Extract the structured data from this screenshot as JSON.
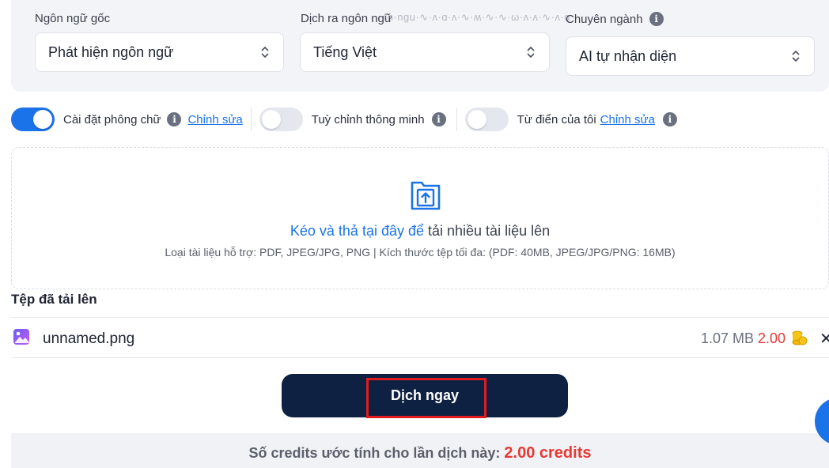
{
  "settings": {
    "source_lang": {
      "label": "Ngôn ngữ gốc",
      "value": "Phát hiện ngôn ngữ"
    },
    "target_lang": {
      "label": "Dịch ra ngôn ngữ",
      "value": "Tiếng Việt"
    },
    "domain": {
      "label": "Chuyên ngành",
      "value": "AI tự nhận diện"
    }
  },
  "toggles": [
    {
      "label": "Cài đặt phông chữ",
      "state": "on",
      "link": "Chỉnh sửa"
    },
    {
      "label": "Tuỳ chỉnh thông minh",
      "state": "off"
    },
    {
      "label": "Từ điển của tôi",
      "state": "off",
      "link": "Chỉnh sửa"
    }
  ],
  "dropzone": {
    "highlight": "Kéo và thả tại đây để",
    "rest": " tải nhiều tài liệu lên",
    "hint": "Loại tài liệu hỗ trợ: PDF, JPEG/JPG, PNG | Kích thước tệp tối đa: (PDF: 40MB, JPEG/JPG/PNG: 16MB)"
  },
  "uploaded": {
    "title": "Tệp đã tải lên",
    "files": [
      {
        "name": "unnamed.png",
        "size": "1.07 MB",
        "credits": "2.00"
      }
    ]
  },
  "action": {
    "translate_label": "Dịch ngay"
  },
  "estimate": {
    "prefix": "Số credits ước tính cho lần dịch này: ",
    "value": "2.00 credits"
  },
  "colors": {
    "accent": "#1a73e8",
    "button": "#0f2142",
    "credit": "#e53935",
    "highlight": "#e21b1b"
  },
  "icons": [
    "chevron-updown-icon",
    "info-icon",
    "upload-folder-icon",
    "image-file-icon",
    "coin-icon",
    "close-icon"
  ]
}
